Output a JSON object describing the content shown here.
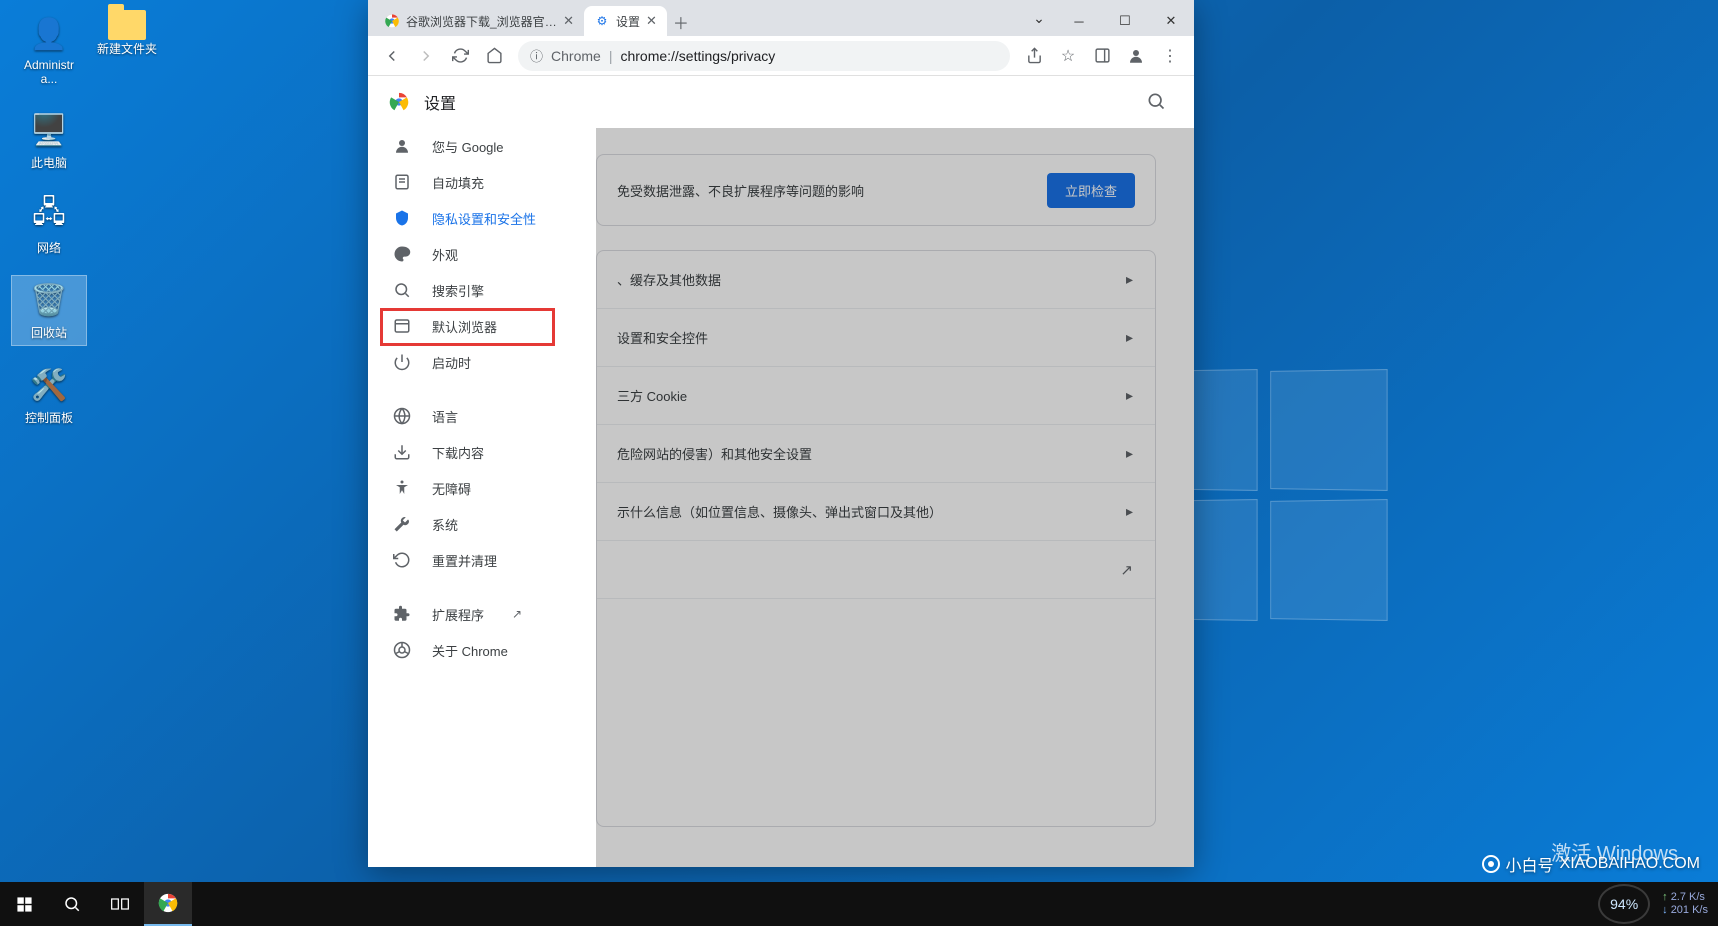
{
  "desktop": {
    "icons": [
      {
        "id": "admin",
        "label": "Administra..."
      },
      {
        "id": "thispc",
        "label": "此电脑"
      },
      {
        "id": "network",
        "label": "网络"
      },
      {
        "id": "recycle",
        "label": "回收站"
      },
      {
        "id": "control",
        "label": "控制面板"
      }
    ],
    "folder2_label": "新建文件夹",
    "activate_title": "激活 Windows",
    "watermark_text": "XIAOBAIHAO.COM",
    "watermark_alt": "@小白号"
  },
  "chrome": {
    "tabs": [
      {
        "title": "谷歌浏览器下载_浏览器官网入口",
        "active": false
      },
      {
        "title": "设置",
        "active": true
      }
    ],
    "omnibox_label": "Chrome",
    "omnibox_url": "chrome://settings/privacy",
    "settings_title": "设置",
    "nav": [
      {
        "icon": "person",
        "label": "您与 Google"
      },
      {
        "icon": "autofill",
        "label": "自动填充"
      },
      {
        "icon": "shield",
        "label": "隐私设置和安全性",
        "active": true
      },
      {
        "icon": "palette",
        "label": "外观"
      },
      {
        "icon": "search",
        "label": "搜索引擎"
      },
      {
        "icon": "browser",
        "label": "默认浏览器"
      },
      {
        "icon": "power",
        "label": "启动时"
      },
      {
        "sep": true
      },
      {
        "icon": "globe",
        "label": "语言"
      },
      {
        "icon": "download",
        "label": "下载内容"
      },
      {
        "icon": "a11y",
        "label": "无障碍"
      },
      {
        "icon": "wrench",
        "label": "系统"
      },
      {
        "icon": "reset",
        "label": "重置并清理"
      },
      {
        "sep": true
      },
      {
        "icon": "ext",
        "label": "扩展程序",
        "external": true
      },
      {
        "icon": "chrome",
        "label": "关于 Chrome"
      }
    ],
    "safety_msg": "免受数据泄露、不良扩展程序等问题的影响",
    "safety_btn": "立即检查",
    "rows": [
      {
        "text": "、缓存及其他数据",
        "chev": true
      },
      {
        "text": "设置和安全控件",
        "chev": true
      },
      {
        "text": "三方 Cookie",
        "chev": true
      },
      {
        "text": "危险网站的侵害）和其他安全设置",
        "chev": true
      },
      {
        "text": "示什么信息（如位置信息、摄像头、弹出式窗口及其他）",
        "chev": true
      },
      {
        "text": "",
        "ext": true
      }
    ]
  },
  "taskbar": {
    "net_pct": "94",
    "net_unit": "%",
    "net_up": "2.7 K/s",
    "net_dn": "201 K/s"
  },
  "brand": {
    "name": "小白号",
    "domain": "XIAOBAIHAO.COM"
  }
}
